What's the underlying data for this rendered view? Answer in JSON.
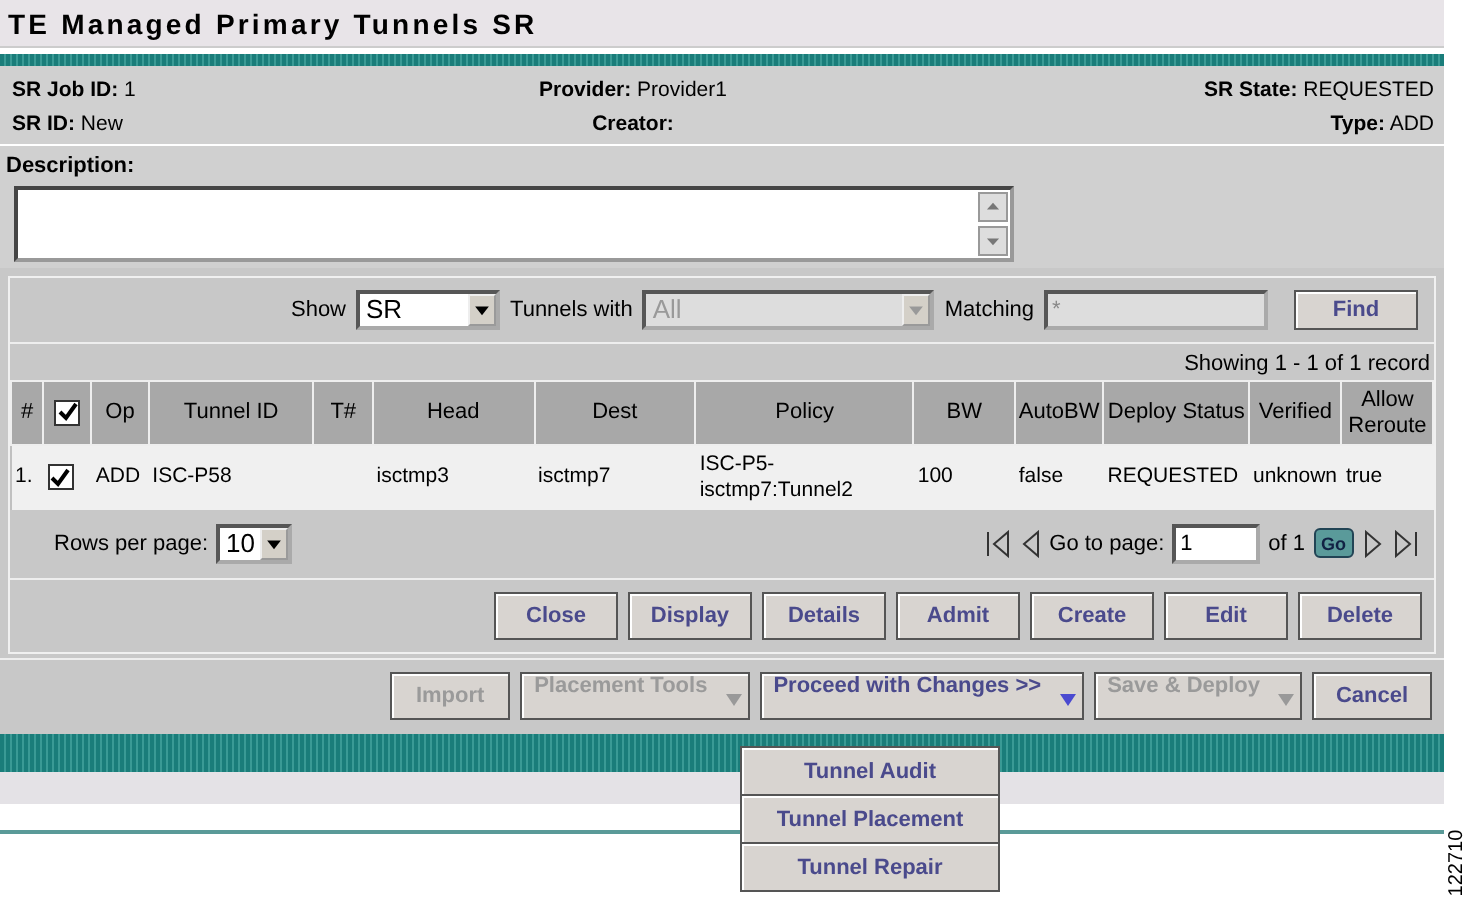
{
  "title": "TE Managed Primary Tunnels SR",
  "info": [
    {
      "label": "SR Job ID:",
      "value": "1"
    },
    {
      "label": "Provider:",
      "value": "Provider1"
    },
    {
      "label": "SR State:",
      "value": "REQUESTED"
    },
    {
      "label": "SR ID:",
      "value": "New"
    },
    {
      "label": "Creator:"
    },
    {
      "label": "Type:",
      "value": "ADD"
    }
  ],
  "description": {
    "label": "Description:"
  },
  "filter": {
    "show_label": "Show",
    "show_value": "SR",
    "tunnels_label": "Tunnels with",
    "tunnels_value": "All",
    "tunnels_disabled": true,
    "matching_label": "Matching",
    "matching_value": "*",
    "matching_disabled": true,
    "find": "Find"
  },
  "showing": "Showing 1 - 1 of 1 record",
  "table": {
    "columns": [
      {
        "label": "#",
        "kind": "text"
      },
      {
        "kind": "checkbox",
        "checked": true
      },
      {
        "label": "Op",
        "kind": "text"
      },
      {
        "label": "Tunnel ID",
        "kind": "text"
      },
      {
        "label": "T#",
        "kind": "text"
      },
      {
        "label": "Head",
        "kind": "text"
      },
      {
        "label": "Dest",
        "kind": "text"
      },
      {
        "label": "Policy",
        "kind": "text"
      },
      {
        "label": "BW",
        "kind": "text"
      },
      {
        "label": "AutoBW",
        "kind": "text"
      },
      {
        "label": "Deploy Status",
        "kind": "text"
      },
      {
        "label": "Verified",
        "kind": "text"
      },
      {
        "label": "Allow Reroute",
        "kind": "text"
      }
    ],
    "rows": [
      {
        "checked": true,
        "cells": [
          "1.",
          "",
          "ADD",
          "ISC-P58",
          "",
          "isctmp3",
          "isctmp7",
          "ISC-P5-isctmp7:Tunnel2",
          "100",
          "false",
          "REQUESTED",
          "unknown",
          "true"
        ]
      }
    ]
  },
  "paging": {
    "rows_label": "Rows per page:",
    "rows_value": "10",
    "goto_label": "Go to page:",
    "page_value": "1",
    "of": "of 1",
    "go": "Go"
  },
  "table_buttons": [
    "Close",
    "Display",
    "Details",
    "Admit",
    "Create",
    "Edit",
    "Delete"
  ],
  "actions": [
    {
      "label": "Import",
      "kind": "button",
      "disabled": true
    },
    {
      "label": "Placement Tools",
      "kind": "split",
      "disabled": true
    },
    {
      "label": "Proceed with Changes >>",
      "kind": "split",
      "disabled": false,
      "expanded": true
    },
    {
      "label": "Save & Deploy",
      "kind": "split",
      "disabled": true
    },
    {
      "label": "Cancel",
      "kind": "button",
      "disabled": false
    }
  ],
  "menu": [
    "Tunnel Audit",
    "Tunnel Placement",
    "Tunnel Repair"
  ],
  "figure_id": "122710"
}
